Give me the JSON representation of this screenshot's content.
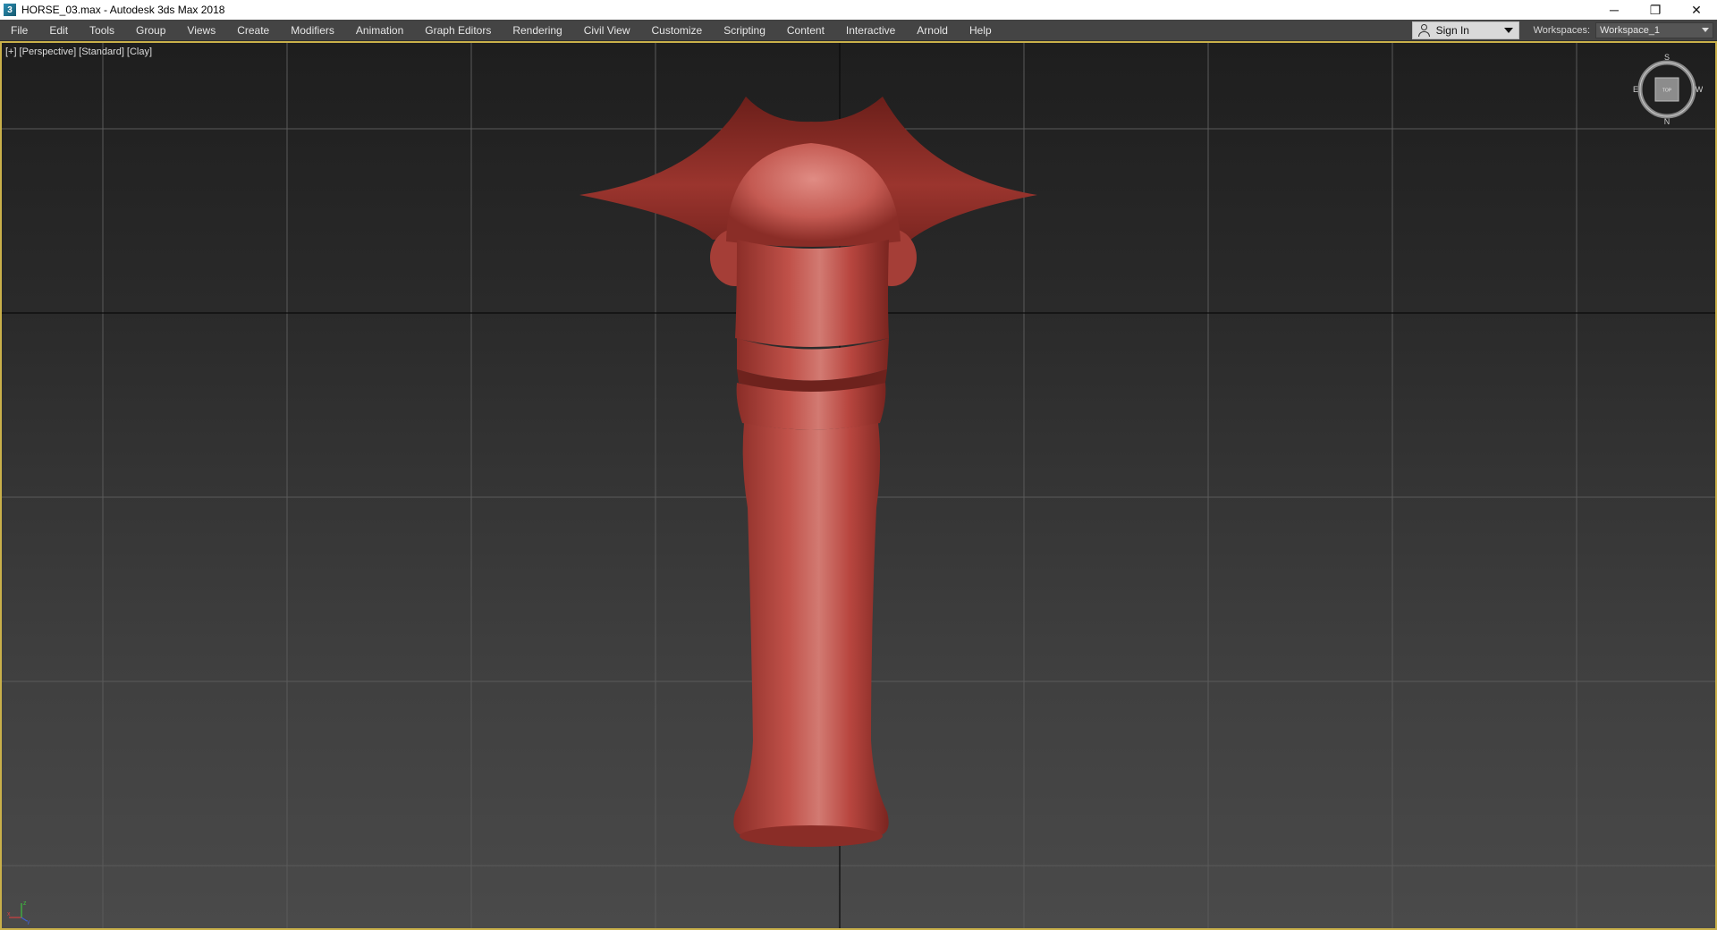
{
  "window": {
    "title": "HORSE_03.max - Autodesk 3ds Max 2018",
    "controls": {
      "minimize": "─",
      "restore": "❐",
      "close": "✕"
    }
  },
  "menubar": {
    "items": [
      {
        "label": "File"
      },
      {
        "label": "Edit"
      },
      {
        "label": "Tools"
      },
      {
        "label": "Group"
      },
      {
        "label": "Views"
      },
      {
        "label": "Create"
      },
      {
        "label": "Modifiers"
      },
      {
        "label": "Animation"
      },
      {
        "label": "Graph Editors"
      },
      {
        "label": "Rendering"
      },
      {
        "label": "Civil View"
      },
      {
        "label": "Customize"
      },
      {
        "label": "Scripting"
      },
      {
        "label": "Content"
      },
      {
        "label": "Interactive"
      },
      {
        "label": "Arnold"
      },
      {
        "label": "Help"
      }
    ],
    "sign_in_label": "Sign In",
    "workspaces_label": "Workspaces:",
    "workspace_value": "Workspace_1"
  },
  "viewport": {
    "labels": {
      "plus": "[+]",
      "view": "[Perspective]",
      "shading_mode": "[Standard]",
      "render_style": "[Clay]"
    },
    "viewcube": {
      "top_letter": "S",
      "bottom_letter": "N",
      "left_letter": "E",
      "right_letter": "W",
      "face_label": "TOP"
    },
    "axis_tripod": {
      "x": "x",
      "y": "y",
      "z": "z"
    }
  },
  "colors": {
    "model": "#b8463f",
    "model_dark": "#7a2520",
    "active_viewport_border": "#c9b04a",
    "grid_line": "#5a5a5a",
    "grid_axis": "#0a0a0a"
  }
}
